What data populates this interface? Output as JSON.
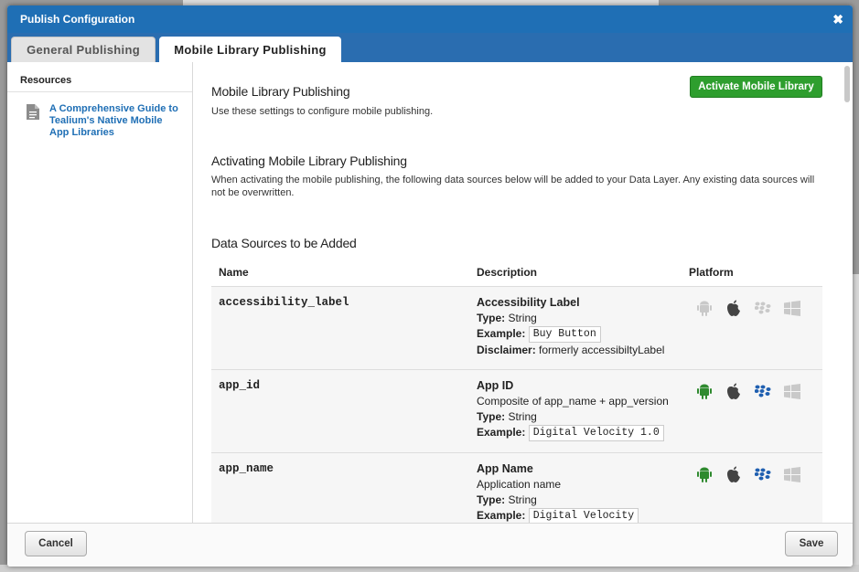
{
  "dialog": {
    "title": "Publish Configuration",
    "close_icon": "close-icon"
  },
  "tabs": [
    {
      "label": "General Publishing",
      "active": false
    },
    {
      "label": "Mobile Library Publishing",
      "active": true
    }
  ],
  "sidebar": {
    "title": "Resources",
    "items": [
      {
        "label": "A Comprehensive Guide to Tealium's Native Mobile App Libraries",
        "icon": "document-icon"
      }
    ]
  },
  "main": {
    "heading": "Mobile Library Publishing",
    "intro": "Use these settings to configure mobile publishing.",
    "activate_button": "Activate Mobile Library",
    "activating_heading": "Activating Mobile Library Publishing",
    "activating_text": "When activating the mobile publishing, the following data sources below will be added to your Data Layer. Any existing data sources will not be overwritten.",
    "ds_heading": "Data Sources to be Added",
    "table": {
      "columns": [
        "Name",
        "Description",
        "Platform"
      ],
      "rows": [
        {
          "name": "accessibility_label",
          "title": "Accessibility Label",
          "desc": "",
          "type_label": "Type:",
          "type": "String",
          "example_label": "Example:",
          "example": "Buy Button",
          "disclaimer_label": "Disclaimer:",
          "disclaimer": "formerly accessibiltyLabel",
          "platforms": {
            "android": false,
            "apple": true,
            "blackberry": false,
            "windows": false
          }
        },
        {
          "name": "app_id",
          "title": "App ID",
          "desc": "Composite of app_name + app_version",
          "type_label": "Type:",
          "type": "String",
          "example_label": "Example:",
          "example": "Digital Velocity 1.0",
          "platforms": {
            "android": true,
            "apple": true,
            "blackberry": true,
            "windows": false
          }
        },
        {
          "name": "app_name",
          "title": "App Name",
          "desc": "Application name",
          "type_label": "Type:",
          "type": "String",
          "example_label": "Example:",
          "example": "Digital Velocity",
          "platforms": {
            "android": true,
            "apple": true,
            "blackberry": true,
            "windows": false
          }
        }
      ]
    }
  },
  "footer": {
    "cancel": "Cancel",
    "save": "Save"
  },
  "colors": {
    "titlebar": "#1f6fb5",
    "activate": "#2e9e2e",
    "link": "#1f6fb5",
    "android_on": "#2f8a2f",
    "blackberry_on": "#1f5fb0",
    "disabled": "#c9c9c9"
  }
}
